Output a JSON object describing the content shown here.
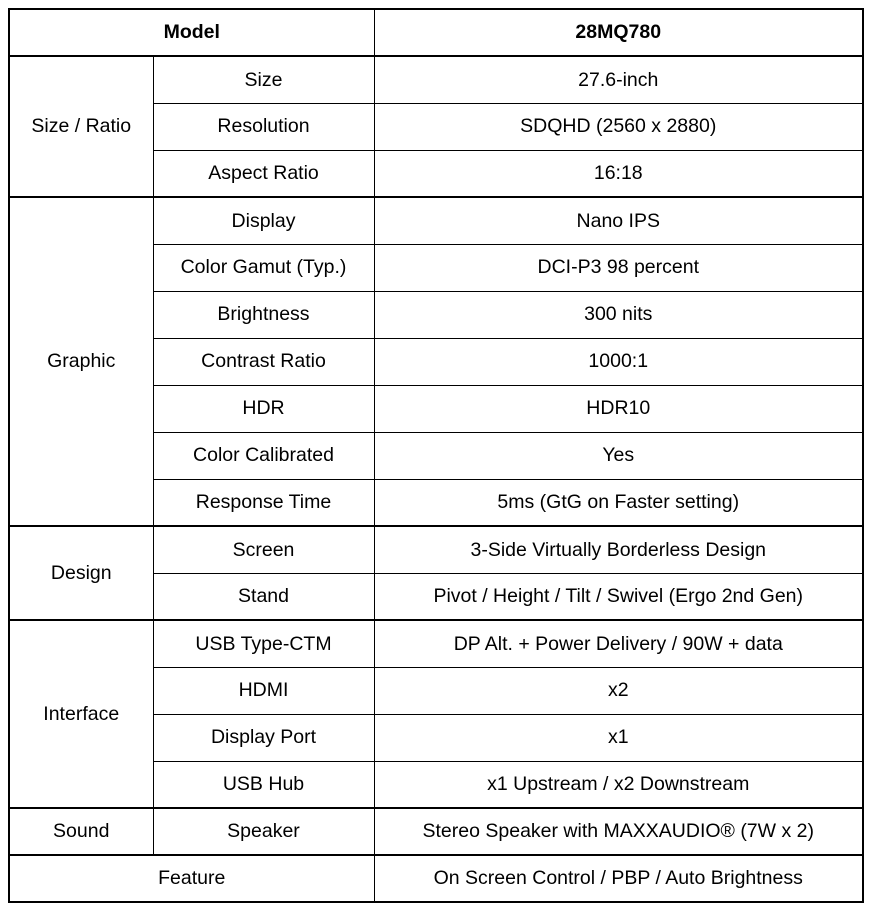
{
  "table": {
    "header": {
      "label": "Model",
      "value": "28MQ780"
    },
    "sections": [
      {
        "group": "Size / Ratio",
        "rows": [
          {
            "item": "Size",
            "value": "27.6-inch"
          },
          {
            "item": "Resolution",
            "value": "SDQHD (2560 x 2880)"
          },
          {
            "item": "Aspect Ratio",
            "value": "16:18"
          }
        ]
      },
      {
        "group": "Graphic",
        "rows": [
          {
            "item": "Display",
            "value": "Nano IPS"
          },
          {
            "item": "Color Gamut (Typ.)",
            "value": "DCI-P3 98 percent"
          },
          {
            "item": "Brightness",
            "value": "300 nits"
          },
          {
            "item": "Contrast Ratio",
            "value": "1000:1"
          },
          {
            "item": "HDR",
            "value": "HDR10"
          },
          {
            "item": "Color Calibrated",
            "value": "Yes"
          },
          {
            "item": "Response Time",
            "value": "5ms (GtG on Faster setting)"
          }
        ]
      },
      {
        "group": "Design",
        "rows": [
          {
            "item": "Screen",
            "value": "3-Side Virtually Borderless Design"
          },
          {
            "item": "Stand",
            "value": "Pivot / Height / Tilt / Swivel (Ergo 2nd Gen)"
          }
        ]
      },
      {
        "group": "Interface",
        "rows": [
          {
            "item": "USB Type-CTM",
            "value": "DP Alt. + Power Delivery / 90W + data"
          },
          {
            "item": "HDMI",
            "value": "x2"
          },
          {
            "item": "Display Port",
            "value": "x1"
          },
          {
            "item": "USB Hub",
            "value": "x1 Upstream / x2 Downstream"
          }
        ]
      },
      {
        "group": "Sound",
        "rows": [
          {
            "item": "Speaker",
            "value": "Stereo Speaker with MAXXAUDIO® (7W x 2)"
          }
        ]
      }
    ],
    "footer": {
      "label": "Feature",
      "value": "On Screen Control / PBP / Auto Brightness"
    }
  },
  "colors": {
    "text": "#000000",
    "background": "#ffffff",
    "border": "#000000"
  }
}
